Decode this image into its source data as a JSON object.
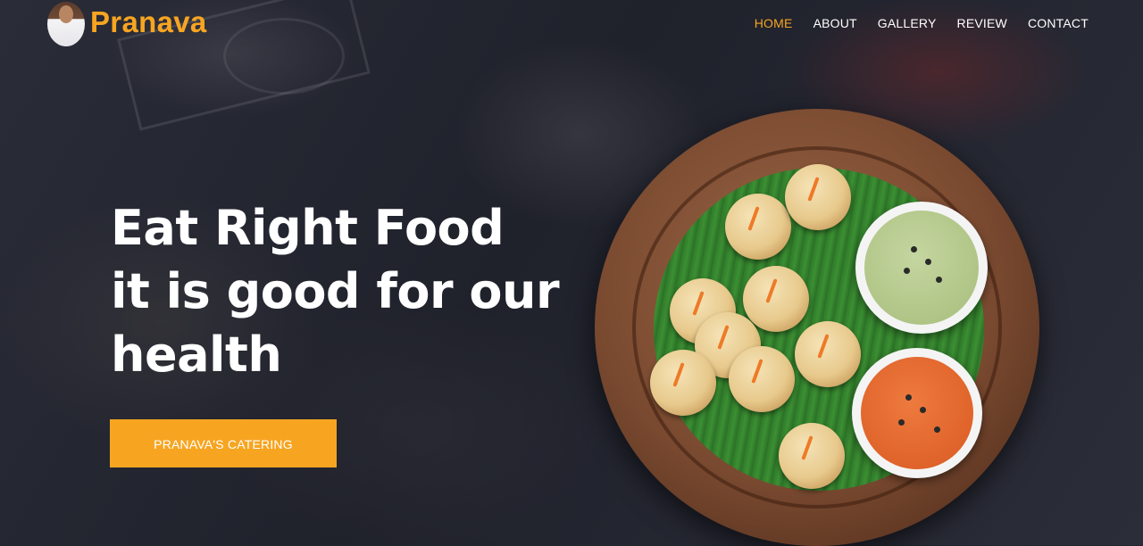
{
  "brand": {
    "name": "Pranava"
  },
  "nav": {
    "items": [
      "HOME",
      "ABOUT",
      "GALLERY",
      "REVIEW",
      "CONTACT"
    ],
    "active": "HOME"
  },
  "hero": {
    "title_lines": [
      "Eat Right Food",
      "it is good for our",
      "health"
    ],
    "cta_label": "PRANAVA'S CATERING"
  },
  "colors": {
    "accent": "#f7a521",
    "background": "#23252f",
    "text": "#ffffff"
  },
  "icons": {
    "logo": "chef-avatar-icon"
  }
}
